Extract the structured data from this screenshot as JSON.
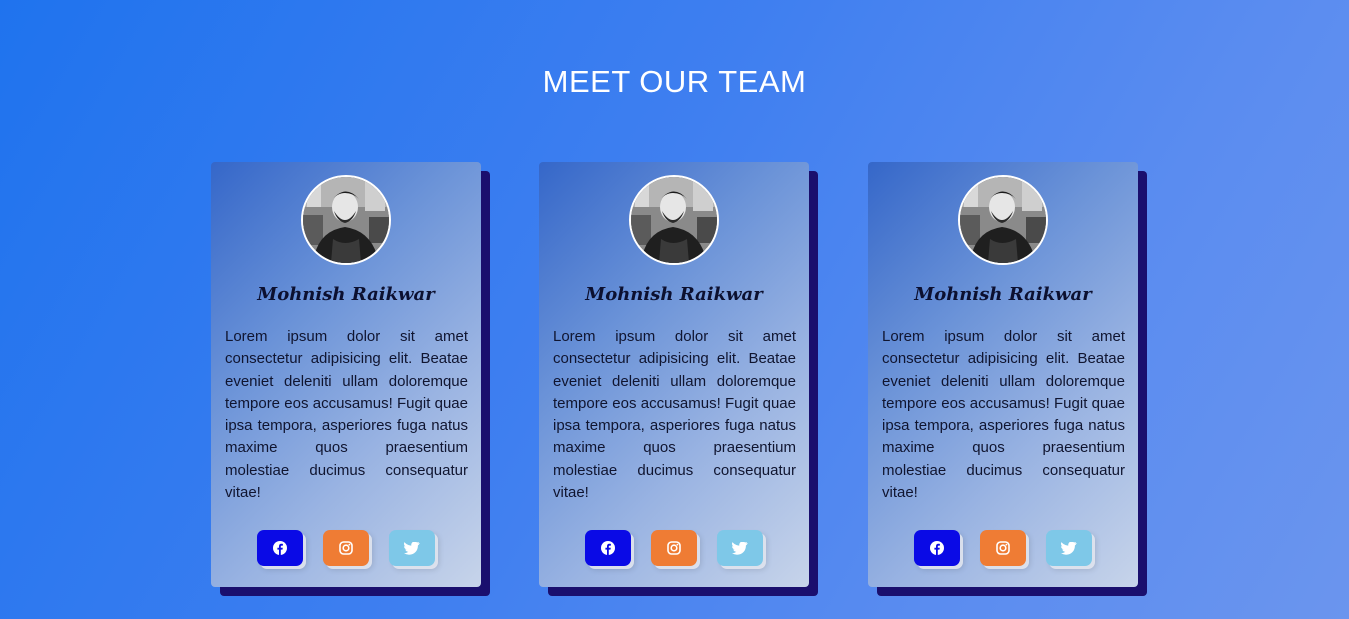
{
  "page": {
    "title": "MEET OUR TEAM"
  },
  "colors": {
    "background_start": "#1f73ee",
    "background_end": "#6b95ee",
    "card_shadow": "#1a0f6e",
    "facebook": "#0a0ae6",
    "instagram": "#ef7c34",
    "twitter": "#7ec8e8"
  },
  "team": [
    {
      "name": "Mohnish Raikwar",
      "bio": "Lorem ipsum dolor sit amet consectetur adipisicing elit. Beatae eveniet deleniti ullam doloremque tempore eos accusamus! Fugit quae ipsa tempora, asperiores fuga natus maxime quos praesentium molestiae ducimus consequatur vitae!",
      "avatar_icon": "profile-photo",
      "socials": [
        "facebook-icon",
        "instagram-icon",
        "twitter-icon"
      ]
    },
    {
      "name": "Mohnish Raikwar",
      "bio": "Lorem ipsum dolor sit amet consectetur adipisicing elit. Beatae eveniet deleniti ullam doloremque tempore eos accusamus! Fugit quae ipsa tempora, asperiores fuga natus maxime quos praesentium molestiae ducimus consequatur vitae!",
      "avatar_icon": "profile-photo",
      "socials": [
        "facebook-icon",
        "instagram-icon",
        "twitter-icon"
      ]
    },
    {
      "name": "Mohnish Raikwar",
      "bio": "Lorem ipsum dolor sit amet consectetur adipisicing elit. Beatae eveniet deleniti ullam doloremque tempore eos accusamus! Fugit quae ipsa tempora, asperiores fuga natus maxime quos praesentium molestiae ducimus consequatur vitae!",
      "avatar_icon": "profile-photo",
      "socials": [
        "facebook-icon",
        "instagram-icon",
        "twitter-icon"
      ]
    }
  ]
}
